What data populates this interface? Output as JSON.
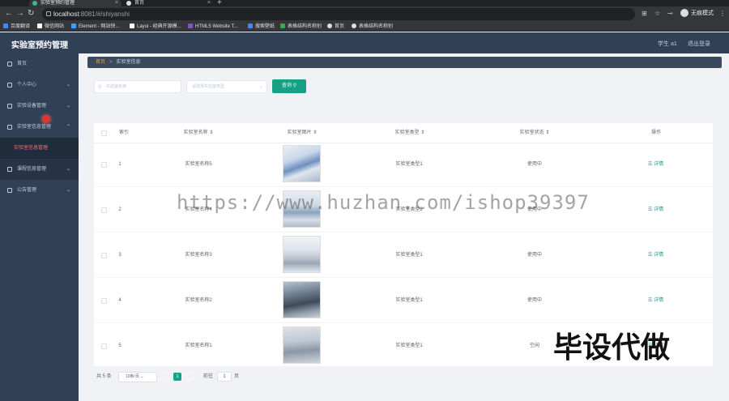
{
  "browser": {
    "tabs": [
      {
        "title": "实验室预约管理",
        "active": true
      },
      {
        "title": "首页",
        "active": false
      }
    ],
    "url_host": "localhost",
    "url_rest": ":8081/#/shiyanshi",
    "profile_label": "无痕模式",
    "bookmarks": [
      "百度翻译",
      "微信网站",
      "Element - 网站快...",
      "Layui - 经典开源模...",
      "HTML5 Website T...",
      "搜索壁纸",
      "表格结构名称别",
      "首页",
      "表格结构名称别"
    ]
  },
  "app": {
    "title": "实验室预约管理",
    "user": "学生 a1",
    "logout": "退出登录"
  },
  "sidebar": {
    "items": [
      {
        "label": "首页",
        "icon": "home-icon"
      },
      {
        "label": "个人中心",
        "icon": "user-icon"
      },
      {
        "label": "实验设备管理",
        "icon": "list-icon"
      },
      {
        "label": "实验室信息管理",
        "icon": "bed-icon"
      },
      {
        "label": "实验室信息管理",
        "icon": "sub"
      },
      {
        "label": "课程信息管理",
        "icon": "doc-icon"
      },
      {
        "label": "公告管理",
        "icon": "chat-icon"
      }
    ]
  },
  "breadcrumb": {
    "home": "首页",
    "current": "实验室信息"
  },
  "search": {
    "name_placeholder": "实验室名称",
    "type_placeholder": "请选择实验室类型",
    "query_label": "查询"
  },
  "table": {
    "headers": [
      "索引",
      "实验室名称",
      "实验室图片",
      "实验室类型",
      "实验室状态",
      "操作"
    ],
    "rows": [
      {
        "index": "1",
        "name": "实验室名称5",
        "type": "实验室类型1",
        "status": "使用中",
        "action": "详情"
      },
      {
        "index": "2",
        "name": "实验室名称4",
        "type": "实验室类型2",
        "status": "使用中",
        "action": "详情"
      },
      {
        "index": "3",
        "name": "实验室名称3",
        "type": "实验室类型1",
        "status": "使用中",
        "action": "详情"
      },
      {
        "index": "4",
        "name": "实验室名称2",
        "type": "实验室类型1",
        "status": "使用中",
        "action": "详情"
      },
      {
        "index": "5",
        "name": "实验室名称1",
        "type": "实验室类型1",
        "status": "空闲",
        "action": "详情"
      }
    ]
  },
  "pagination": {
    "total": "共 5 条",
    "page_size": "10条/页",
    "current_page": "1",
    "goto_label": "前往",
    "goto_value": "1",
    "page_suffix": "页"
  },
  "overlay": {
    "watermark": "https://www.huzhan.com/ishop39397",
    "stamp": "毕设代做"
  },
  "colors": {
    "sidebar": "#304156",
    "accent": "#16a085",
    "active_submenu": "#f56c6c"
  }
}
